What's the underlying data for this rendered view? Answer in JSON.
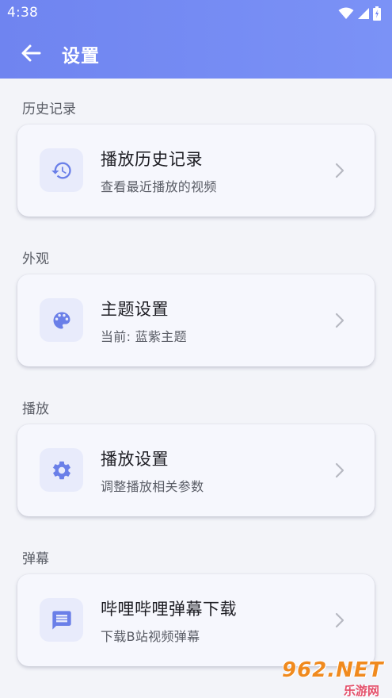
{
  "status_bar": {
    "time": "4:38"
  },
  "app_bar": {
    "title": "设置"
  },
  "sections": [
    {
      "label": "历史记录",
      "card": {
        "title": "播放历史记录",
        "subtitle": "查看最近播放的视频",
        "icon": "history-icon"
      }
    },
    {
      "label": "外观",
      "card": {
        "title": "主题设置",
        "subtitle": "当前: 蓝紫主题",
        "icon": "palette-icon"
      }
    },
    {
      "label": "播放",
      "card": {
        "title": "播放设置",
        "subtitle": "调整播放相关参数",
        "icon": "gear-icon"
      }
    },
    {
      "label": "弹幕",
      "card": {
        "title": "哔哩哔哩弹幕下载",
        "subtitle": "下载B站视频弹幕",
        "icon": "comment-icon"
      }
    }
  ],
  "watermark": {
    "main": "962.NET",
    "sub": "乐游网"
  },
  "colors": {
    "header": "#7589f3",
    "icon": "#6a7fe8",
    "icon_bg": "#e8ebfb",
    "background": "#f3f4f9"
  }
}
